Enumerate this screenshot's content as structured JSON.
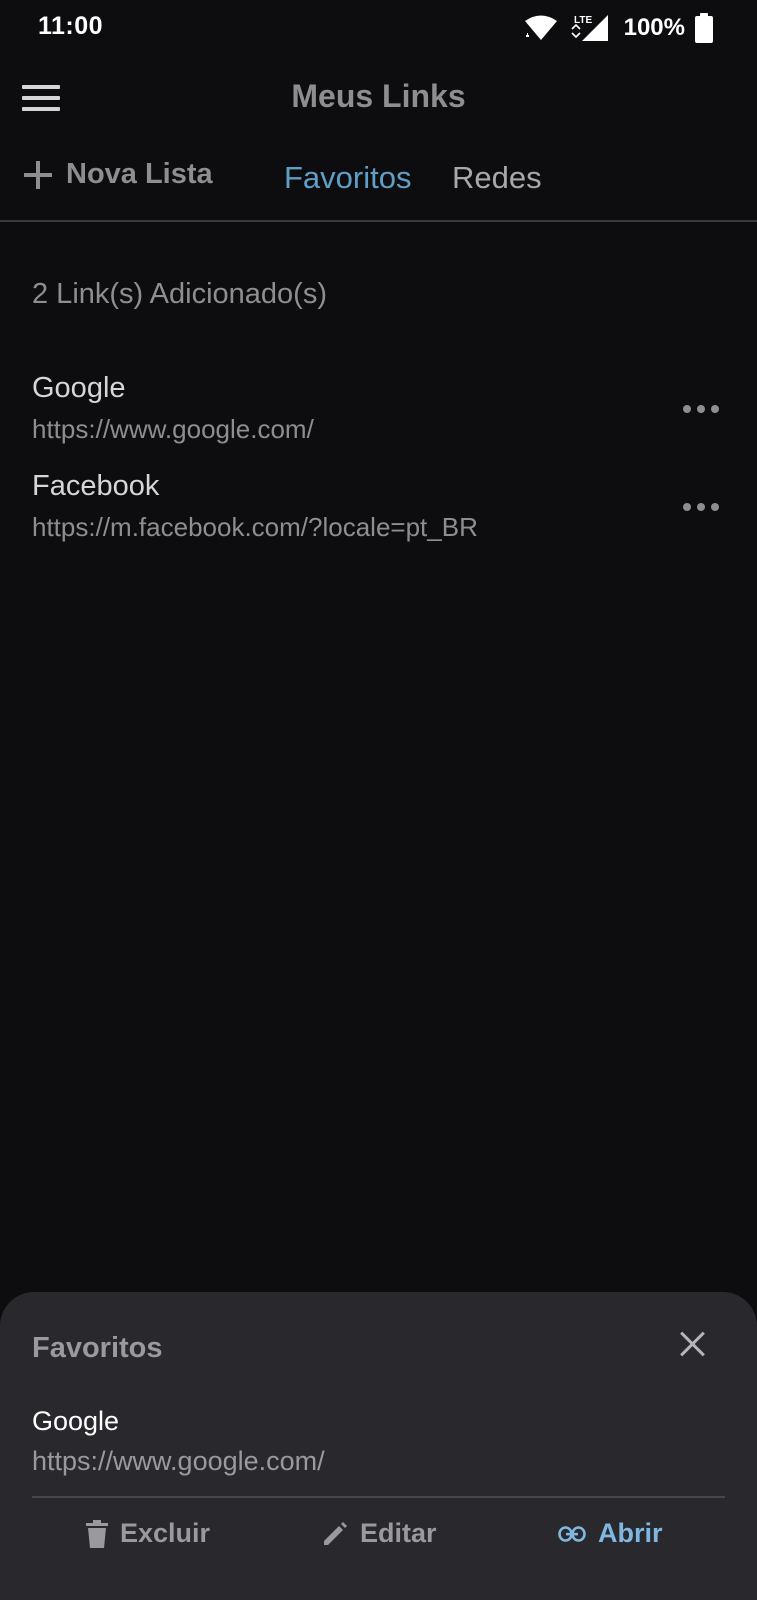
{
  "status_bar": {
    "time": "11:00",
    "network_label": "LTE",
    "battery": "100%"
  },
  "app_bar": {
    "title": "Meus Links"
  },
  "tabs": {
    "new_list_label": "Nova Lista",
    "items": [
      {
        "label": "Favoritos",
        "active": true
      },
      {
        "label": "Redes",
        "active": false
      }
    ]
  },
  "content": {
    "count_text": "2 Link(s) Adicionado(s)",
    "links": [
      {
        "title": "Google",
        "url": "https://www.google.com/"
      },
      {
        "title": "Facebook",
        "url": "https://m.facebook.com/?locale=pt_BR"
      }
    ]
  },
  "sheet": {
    "title": "Favoritos",
    "link_title": "Google",
    "link_url": "https://www.google.com/",
    "actions": {
      "delete_label": "Excluir",
      "edit_label": "Editar",
      "open_label": "Abrir"
    }
  },
  "colors": {
    "background": "#0d0d0f",
    "accent": "#5f9fc7",
    "sheet_background": "#28282d",
    "open_action": "#7fb7e0"
  },
  "icons": [
    "wifi-icon",
    "cellular-signal-icon",
    "battery-icon",
    "menu-icon",
    "plus-icon",
    "more-icon",
    "close-icon",
    "trash-icon",
    "pencil-icon",
    "link-icon"
  ]
}
